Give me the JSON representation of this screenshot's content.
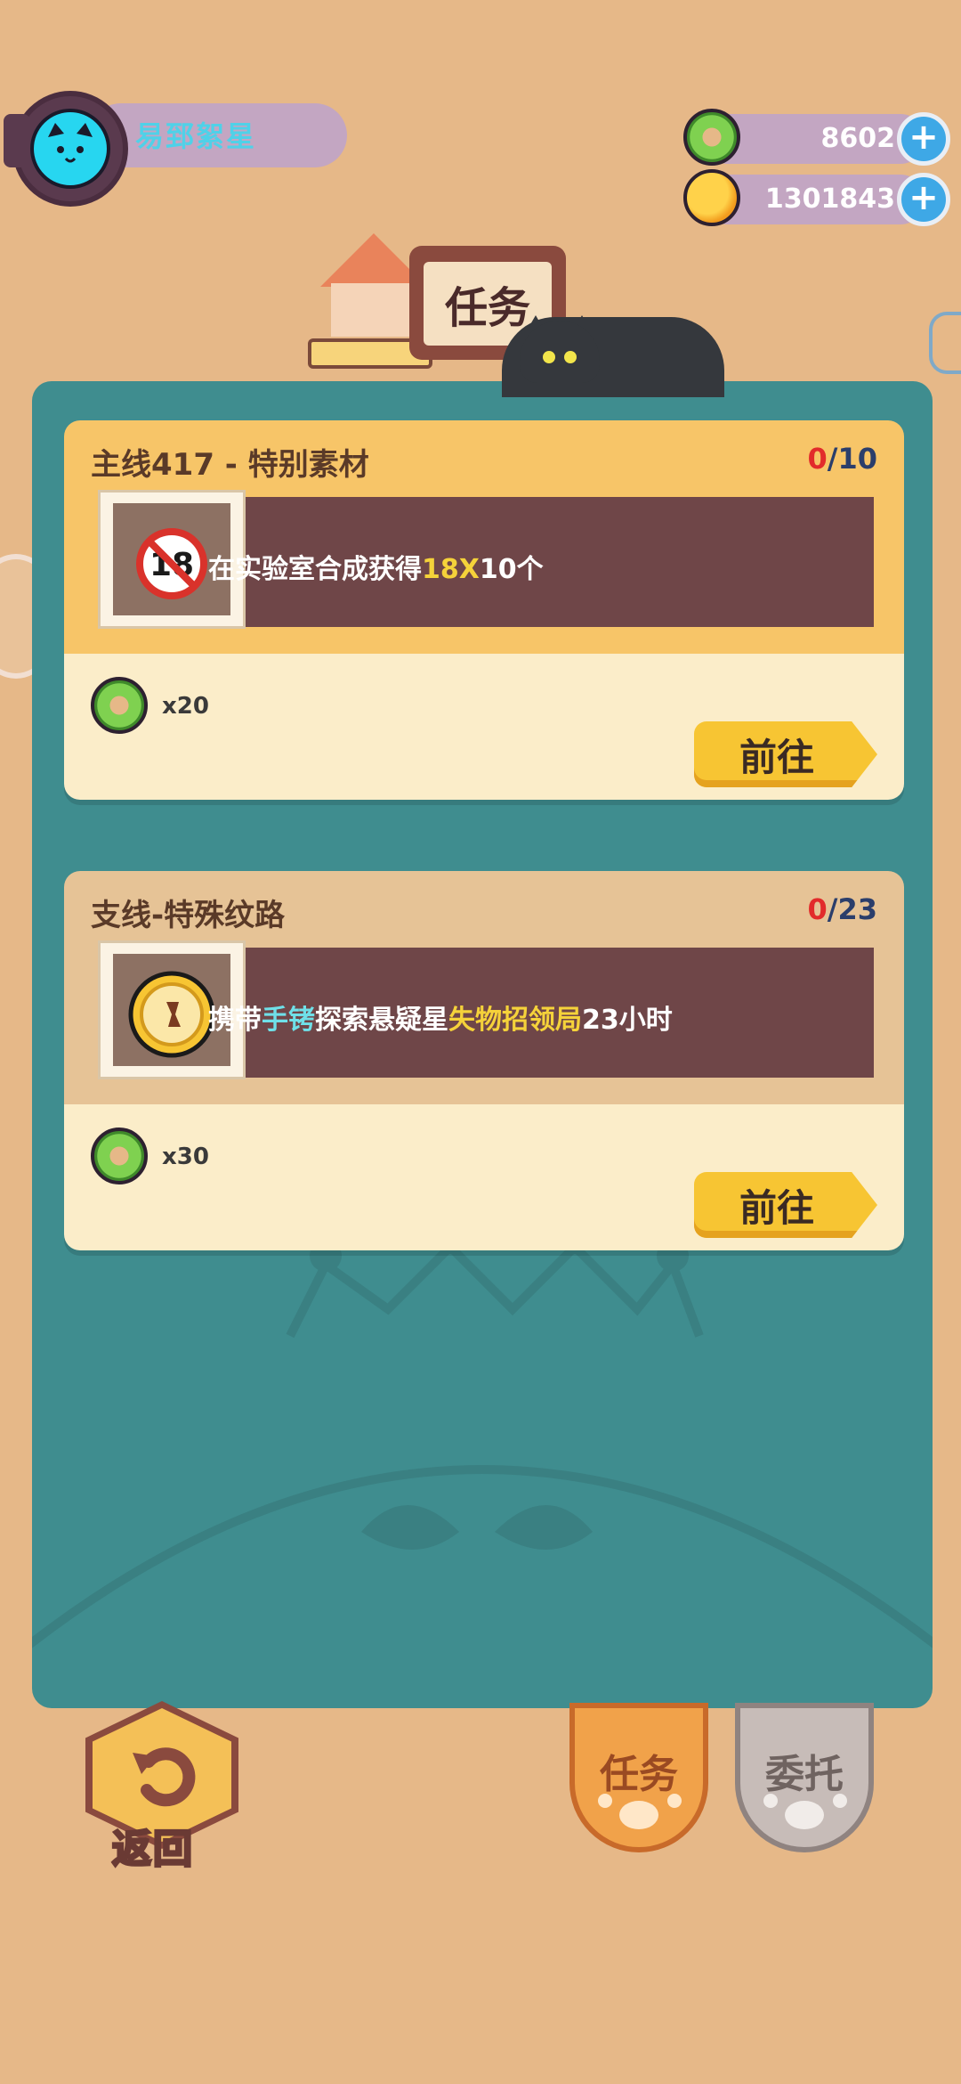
{
  "player": {
    "name": "易郅絮星"
  },
  "resources": [
    {
      "icon": "donut-icon",
      "value": "8602"
    },
    {
      "icon": "planet-coin-icon",
      "value": "1301843"
    }
  ],
  "header": {
    "title": "任务"
  },
  "tasks": [
    {
      "title": "主线417 - 特别素材",
      "progress_current": "0",
      "progress_total": "/10",
      "desc_parts": [
        "在实验室合成获得",
        "18X",
        "10个"
      ],
      "reward_count": "x20",
      "button_label": "前往",
      "head_color": "#f7c568"
    },
    {
      "title": "支线-特殊纹路",
      "progress_current": "0",
      "progress_total": "/23",
      "desc_parts": [
        "携带",
        "手铐",
        "探索悬疑星",
        "失物招领局",
        "23小时"
      ],
      "reward_count": "x30",
      "button_label": "前往",
      "head_color": "#e6c396"
    }
  ],
  "bottom": {
    "back_label": "返回",
    "tabs": [
      {
        "label": "任务",
        "active": true
      },
      {
        "label": "委托",
        "active": false
      }
    ]
  },
  "colors": {
    "background": "#e6b888",
    "panel": "#3f8d8f",
    "accent_yellow": "#f7c533",
    "progress_red": "#e22b2b"
  }
}
